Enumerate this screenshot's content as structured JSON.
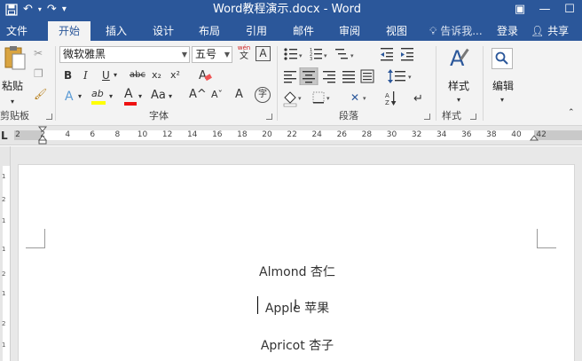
{
  "window": {
    "title": "Word教程演示.docx - Word",
    "quick_access": {
      "save_icon": "save-icon",
      "undo_glyph": "↶",
      "redo_glyph": "↷",
      "customize_glyph": "▾"
    },
    "controls": {
      "display_options": "▣",
      "minimize": "—",
      "maximize": "☐"
    }
  },
  "tabs": [
    "文件",
    "开始",
    "插入",
    "设计",
    "布局",
    "引用",
    "邮件",
    "审阅",
    "视图"
  ],
  "active_tab": "开始",
  "tell_me": "告诉我...",
  "login": "登录",
  "share": "共享",
  "ribbon": {
    "clipboard": {
      "label": "剪贴板",
      "paste": "粘贴"
    },
    "font": {
      "label": "字体",
      "name": "微软雅黑",
      "size": "五号",
      "wen_label": "wén",
      "wen_char": "文",
      "boxed_a": "A",
      "bold": "B",
      "italic": "I",
      "underline": "U",
      "strike": "abc",
      "subscript": "x₂",
      "superscript": "x²",
      "text_effects": "A",
      "highlight": "ab",
      "font_color": "A",
      "change_case": "Aa",
      "grow": "A^",
      "shrink": "Aˇ",
      "phonetic": "A",
      "enclose": "字"
    },
    "paragraph": {
      "label": "段落"
    },
    "styles": {
      "label": "样式",
      "button": "样式"
    },
    "editing": {
      "button": "编辑"
    }
  },
  "ruler": {
    "tab_marker": "L",
    "labels": [
      "2",
      "2",
      "4",
      "6",
      "8",
      "10",
      "12",
      "14",
      "16",
      "18",
      "20",
      "22",
      "24",
      "26",
      "28",
      "30",
      "32",
      "34",
      "36",
      "38",
      "40",
      "42"
    ]
  },
  "vertical_ruler": {
    "labels": [
      "1",
      "2",
      "1",
      "1",
      "2",
      "1",
      "2",
      "1"
    ]
  },
  "document": {
    "lines": [
      "Almond  杏仁",
      "Apple  苹果",
      "Apricot  杏子"
    ]
  },
  "colors": {
    "titlebar": "#2b579a",
    "ribbon": "#f3f3f3",
    "highlight_yellow": "#ffff00",
    "font_red": "#e11"
  }
}
